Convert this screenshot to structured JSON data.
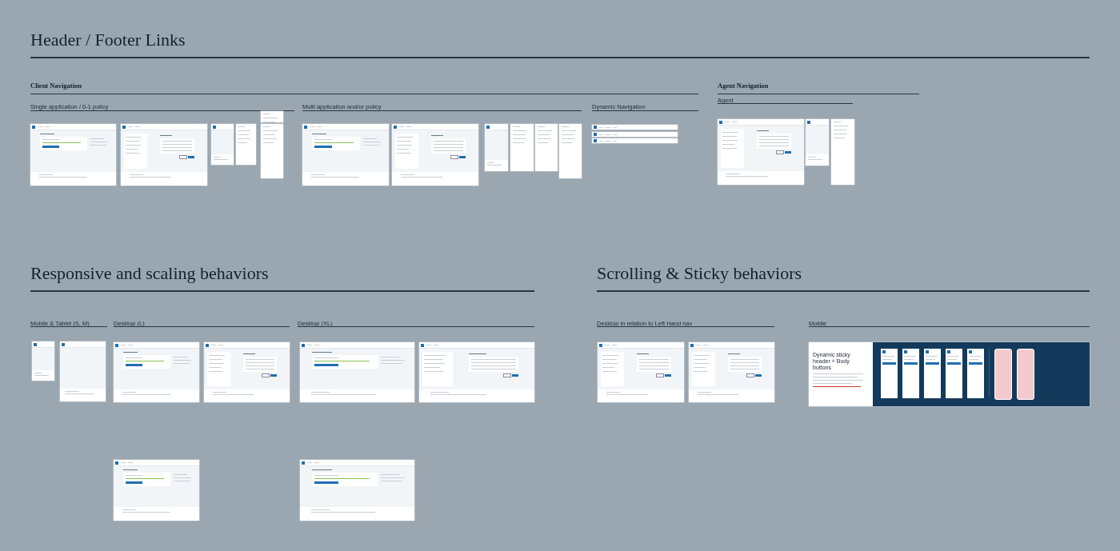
{
  "sections": [
    {
      "title": "Header / Footer Links",
      "groups": [
        {
          "title": "Client Navigation",
          "subsections": [
            {
              "title": "Single application / 0-1 policy",
              "frames": [
                {
                  "kind": "home"
                },
                {
                  "kind": "form"
                },
                {
                  "kind": "mobile"
                },
                {
                  "kind": "menu"
                },
                {
                  "kind": "menu"
                },
                {
                  "kind": "menu"
                }
              ]
            },
            {
              "title": "Multi application and/or policy",
              "frames": [
                {
                  "kind": "home"
                },
                {
                  "kind": "form"
                },
                {
                  "kind": "mobile"
                },
                {
                  "kind": "menu"
                },
                {
                  "kind": "menu"
                },
                {
                  "kind": "menu"
                }
              ]
            },
            {
              "title": "Dynamic Navigation",
              "frames": [
                {
                  "kind": "nav-bar"
                },
                {
                  "kind": "nav-bar"
                },
                {
                  "kind": "nav-bar"
                }
              ]
            }
          ]
        },
        {
          "title": "Agent Navigation",
          "subsections": [
            {
              "title": "Agent",
              "frames": [
                {
                  "kind": "form"
                },
                {
                  "kind": "mobile"
                },
                {
                  "kind": "menu"
                }
              ]
            }
          ]
        }
      ]
    },
    {
      "title": "Responsive and scaling behaviors",
      "groups": [
        {
          "subsections": [
            {
              "title": "Mobile & Tablet (S, M)",
              "frames": [
                {
                  "kind": "mobile"
                },
                {
                  "kind": "mobile"
                }
              ]
            },
            {
              "title": "Desktop (L)",
              "frames": [
                {
                  "kind": "home"
                },
                {
                  "kind": "form"
                },
                {
                  "kind": "home"
                }
              ]
            },
            {
              "title": "Desktop (XL)",
              "frames": [
                {
                  "kind": "home"
                },
                {
                  "kind": "form"
                },
                {
                  "kind": "home"
                }
              ]
            }
          ]
        }
      ]
    },
    {
      "title": "Scrolling & Sticky behaviors",
      "groups": [
        {
          "subsections": [
            {
              "title": "Desktop in relation to Left Hand nav",
              "frames": [
                {
                  "kind": "form"
                },
                {
                  "kind": "form"
                }
              ]
            },
            {
              "title": "Mobile",
              "frames": [
                {
                  "kind": "showcase",
                  "heading": "Dynamic sticky header + Body buttons"
                }
              ]
            }
          ]
        }
      ]
    }
  ]
}
